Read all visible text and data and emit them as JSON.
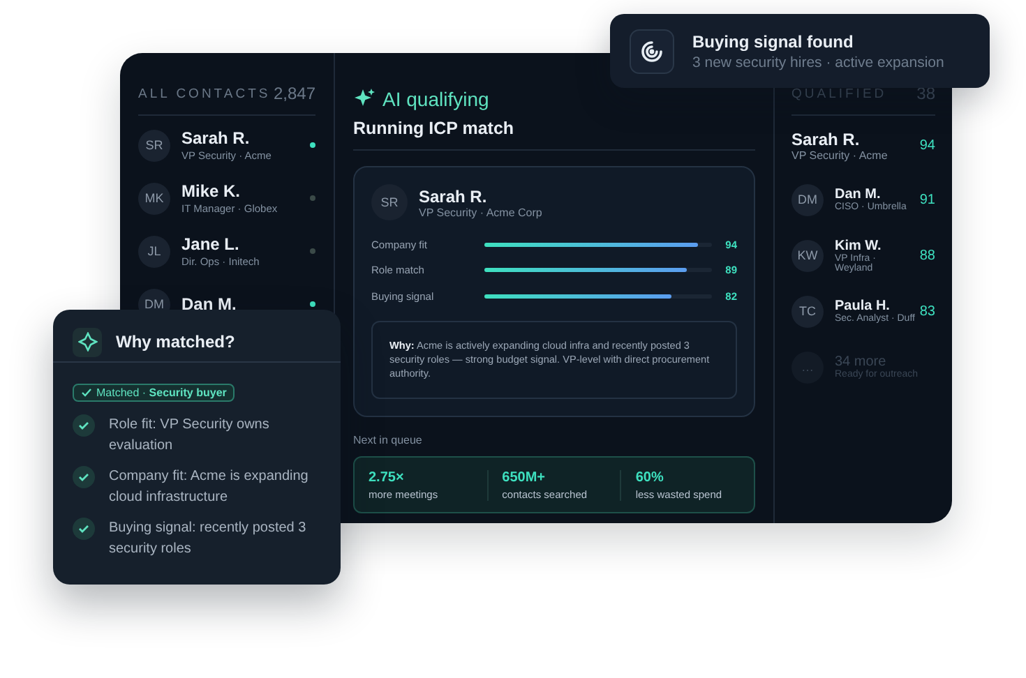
{
  "contacts": {
    "title": "ALL CONTACTS",
    "count": "2,847",
    "items": [
      {
        "initials": "SR",
        "name": "Sarah R.",
        "role": "VP Security · Acme",
        "active": true
      },
      {
        "initials": "MK",
        "name": "Mike K.",
        "role": "IT Manager · Globex",
        "active": false
      },
      {
        "initials": "JL",
        "name": "Jane L.",
        "role": "Dir. Ops · Initech",
        "active": false
      },
      {
        "initials": "DM",
        "name": "Dan M.",
        "active": true
      }
    ]
  },
  "qualifying": {
    "label": "AI qualifying",
    "title": "Running ICP match",
    "card": {
      "initials": "SR",
      "name": "Sarah R.",
      "role": "VP Security · Acme Corp",
      "scores": [
        {
          "label": "Company fit",
          "level": 0.94,
          "value": "94"
        },
        {
          "label": "Role match",
          "level": 0.89,
          "value": "89"
        },
        {
          "label": "Buying signal",
          "level": 0.82,
          "value": "82"
        }
      ],
      "why": "**Why:** Acme is actively expanding cloud infra and recently posted 3 security roles — strong budget signal. VP-level with direct procurement authority."
    },
    "queue_label": "Next in queue",
    "stats": [
      {
        "value": "2.75×",
        "label": "more meetings"
      },
      {
        "value": "650M+",
        "label": "contacts searched"
      },
      {
        "value": "60%",
        "label": "less wasted spend"
      }
    ]
  },
  "qualified": {
    "title": "QUALIFIED",
    "count": "38",
    "items": [
      {
        "kind": "featured",
        "name": "Sarah R.",
        "role": "VP Security · Acme",
        "score": "94"
      },
      {
        "kind": "contact",
        "initials": "DM",
        "name": "Dan M.",
        "role": "CISO · Umbrella",
        "score": "91"
      },
      {
        "kind": "contact",
        "initials": "KW",
        "name": "Kim W.",
        "role": "VP Infra · Weyland",
        "score": "88"
      },
      {
        "kind": "contact",
        "initials": "TC",
        "name": "Paula H.",
        "role": "Sec. Analyst · Duff",
        "score": "83"
      },
      {
        "kind": "more",
        "initials": "…",
        "name": "34 more",
        "role": "Ready for outreach"
      }
    ]
  },
  "notification": {
    "title": "Buying signal found",
    "subtitle": "3 new security hires · active expansion"
  },
  "why_matched": {
    "title": "Why matched?",
    "chip": "Matched · **Security buyer**",
    "reasons": [
      "Role fit: VP Security owns evaluation",
      "Company fit: Acme is expanding cloud infrastructure",
      "Buying signal: recently posted 3 security roles"
    ]
  }
}
